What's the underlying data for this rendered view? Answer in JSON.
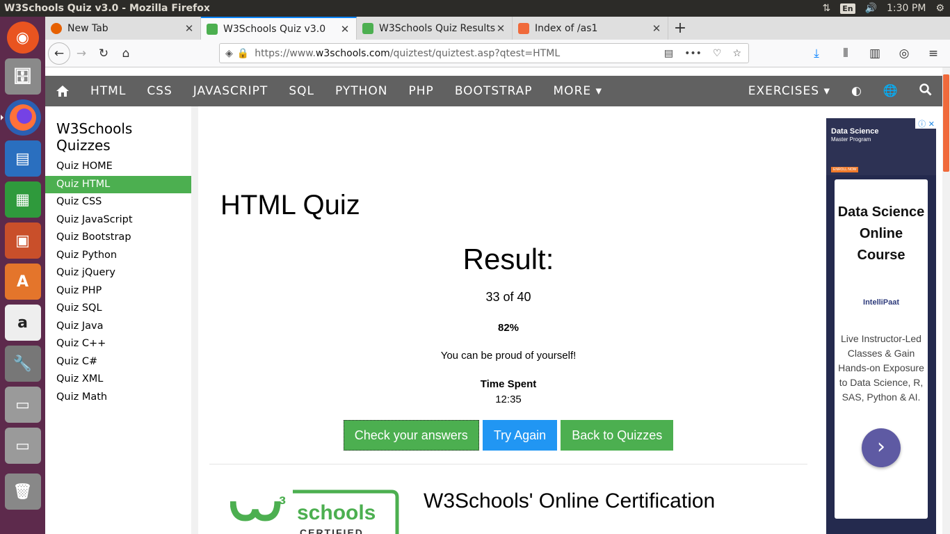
{
  "topbar": {
    "title": "W3Schools Quiz v3.0 - Mozilla Firefox",
    "kbd": "En",
    "time": "1:30 PM"
  },
  "launcher": {
    "icons": [
      "ubuntu-icon",
      "files-icon",
      "firefox-icon",
      "writer-icon",
      "calc-icon",
      "impress-icon",
      "software-center-icon",
      "amazon-icon",
      "settings-icon",
      "drive-icon",
      "drive-icon",
      "trash-icon"
    ]
  },
  "tabs": [
    {
      "label": "New Tab",
      "color": "#e66000"
    },
    {
      "label": "W3Schools Quiz v3.0",
      "color": "#4caf50"
    },
    {
      "label": "W3Schools Quiz Results",
      "color": "#4caf50"
    },
    {
      "label": "Index of /as1",
      "color": "#f06a3b"
    }
  ],
  "urlbar": {
    "prefix": "https://www.",
    "domain": "w3schools.com",
    "path": "/quiztest/quiztest.asp?qtest=HTML"
  },
  "w3nav": {
    "items": [
      "HTML",
      "CSS",
      "JAVASCRIPT",
      "SQL",
      "PYTHON",
      "PHP",
      "BOOTSTRAP",
      "MORE ▾"
    ],
    "exercises": "EXERCISES ▾"
  },
  "sidebar": {
    "heading": "W3Schools Quizzes",
    "items": [
      "Quiz HOME",
      "Quiz HTML",
      "Quiz CSS",
      "Quiz JavaScript",
      "Quiz Bootstrap",
      "Quiz Python",
      "Quiz jQuery",
      "Quiz PHP",
      "Quiz SQL",
      "Quiz Java",
      "Quiz C++",
      "Quiz C#",
      "Quiz XML",
      "Quiz Math"
    ],
    "selected_index": 1
  },
  "main": {
    "title": "HTML Quiz",
    "result_label": "Result:",
    "score": "33 of 40",
    "percent": "82%",
    "message": "You can be proud of yourself!",
    "time_label": "Time Spent",
    "time_value": "12:35",
    "buttons": {
      "check": "Check your answers",
      "again": "Try Again",
      "back": "Back to Quizzes"
    },
    "cert_title": "W3Schools' Online Certification",
    "cert_logo_text": "schools",
    "cert_logo_sub": "CERTIFIED"
  },
  "ad": {
    "banner_title": "Data Science",
    "banner_sub": "Master Program",
    "headline": "Data Science Online Course",
    "brand": "IntelliPaat",
    "body": "Live Instructor-Led Classes & Gain Hands-on Exposure to Data Science, R, SAS, Python & AI."
  },
  "colors": {
    "w3green": "#4caf50",
    "w3blue": "#2196f3",
    "navgray": "#616161"
  }
}
